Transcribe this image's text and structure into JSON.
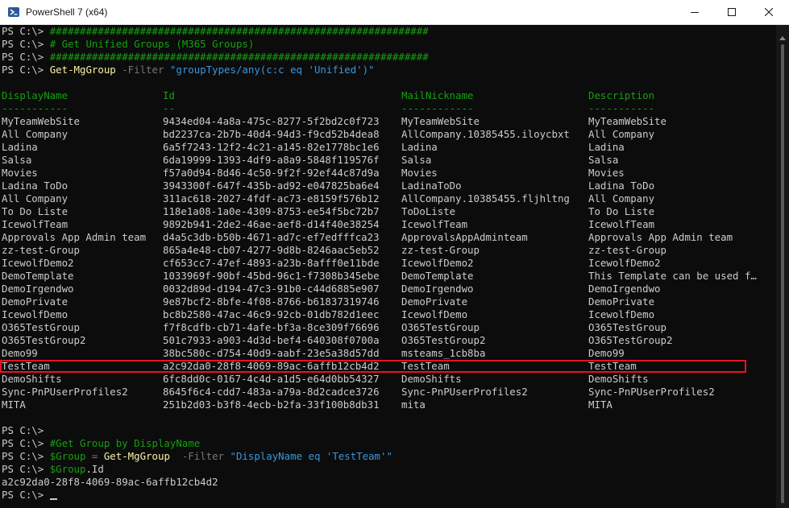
{
  "window": {
    "title": "PowerShell 7 (x64)"
  },
  "terminal": {
    "prompt": "PS C:\\> ",
    "comment_hashes": "###############################################################",
    "comment_title": "# Get Unified Groups (M365 Groups)",
    "cmd1": {
      "cmdlet": "Get-MgGroup",
      "param": "-Filter",
      "value": "\"groupTypes/any(c:c eq 'Unified')\""
    },
    "table": {
      "headers": [
        "DisplayName",
        "Id",
        "MailNickname",
        "Description"
      ],
      "underlines": [
        "-----------",
        "--",
        "------------",
        "-----------"
      ],
      "rows": [
        [
          "MyTeamWebSite",
          "9434ed04-4a8a-475c-8277-5f2bd2c0f723",
          "MyTeamWebSite",
          "MyTeamWebSite"
        ],
        [
          "All Company",
          "bd2237ca-2b7b-40d4-94d3-f9cd52b4dea8",
          "AllCompany.10385455.iloycbxt",
          "All Company"
        ],
        [
          "Ladina",
          "6a5f7243-12f2-4c21-a145-82e1778bc1e6",
          "Ladina",
          "Ladina"
        ],
        [
          "Salsa",
          "6da19999-1393-4df9-a8a9-5848f119576f",
          "Salsa",
          "Salsa"
        ],
        [
          "Movies",
          "f57a0d94-8d46-4c50-9f2f-92ef44c87d9a",
          "Movies",
          "Movies"
        ],
        [
          "Ladina ToDo",
          "3943300f-647f-435b-ad92-e047825ba6e4",
          "LadinaToDo",
          "Ladina ToDo"
        ],
        [
          "All Company",
          "311ac618-2027-4fdf-ac73-e8159f576b12",
          "AllCompany.10385455.fljhltng",
          "All Company"
        ],
        [
          "To Do Liste",
          "118e1a08-1a0e-4309-8753-ee54f5bc72b7",
          "ToDoListe",
          "To Do Liste"
        ],
        [
          "IcewolfTeam",
          "9892b941-2de2-46ae-aef8-d14f40e38254",
          "IcewolfTeam",
          "IcewolfTeam"
        ],
        [
          "Approvals App Admin team",
          "d4a5c3db-b50b-4671-ad7c-ef7edfffca23",
          "ApprovalsAppAdminteam",
          "Approvals App Admin team"
        ],
        [
          "zz-test-Group",
          "865a4e48-cb07-4277-9d8b-8246aac5eb52",
          "zz-test-Group",
          "zz-test-Group"
        ],
        [
          "IcewolfDemo2",
          "cf653cc7-47ef-4893-a23b-8afff0e11bde",
          "IcewolfDemo2",
          "IcewolfDemo2"
        ],
        [
          "DemoTemplate",
          "1033969f-90bf-45bd-96c1-f7308b345ebe",
          "DemoTemplate",
          "This Template can be used f…"
        ],
        [
          "DemoIrgendwo",
          "0032d89d-d194-47c3-91b0-c44d6885e907",
          "DemoIrgendwo",
          "DemoIrgendwo"
        ],
        [
          "DemoPrivate",
          "9e87bcf2-8bfe-4f08-8766-b61837319746",
          "DemoPrivate",
          "DemoPrivate"
        ],
        [
          "IcewolfDemo",
          "bc8b2580-47ac-46c9-92cb-01db782d1eec",
          "IcewolfDemo",
          "IcewolfDemo"
        ],
        [
          "O365TestGroup",
          "f7f8cdfb-cb71-4afe-bf3a-8ce309f76696",
          "O365TestGroup",
          "O365TestGroup"
        ],
        [
          "O365TestGroup2",
          "501c7933-a903-4d3d-bef4-640308f0700a",
          "O365TestGroup2",
          "O365TestGroup2"
        ],
        [
          "Demo99",
          "38bc580c-d754-40d9-aabf-23e5a38d57dd",
          "msteams_1cb8ba",
          "Demo99"
        ],
        [
          "TestTeam",
          "a2c92da0-28f8-4069-89ac-6affb12cb4d2",
          "TestTeam",
          "TestTeam"
        ],
        [
          "DemoShifts",
          "6fc8dd0c-0167-4c4d-a1d5-e64d0bb54327",
          "DemoShifts",
          "DemoShifts"
        ],
        [
          "Sync-PnPUserProfiles2",
          "8645f6c4-cdd7-483a-a79a-8d2cadce3726",
          "Sync-PnPUserProfiles2",
          "Sync-PnPUserProfiles2"
        ],
        [
          "MITA",
          "251b2d03-b3f8-4ecb-b2fa-33f100b8db31",
          "mita",
          "MITA"
        ]
      ]
    },
    "comment2": "#Get Group by DisplayName",
    "cmd2": {
      "var": "$Group",
      "eq": " = ",
      "cmdlet": "Get-MgGroup",
      "param": "  -Filter",
      "value": " \"DisplayName eq 'TestTeam'\""
    },
    "cmd3": {
      "var": "$Group",
      "prop": ".Id"
    },
    "output_id": "a2c92da0-28f8-4069-89ac-6affb12cb4d2"
  },
  "colors": {
    "background": "#0c0c0c",
    "comment": "#13a10e",
    "cmdlet": "#f9f1a5",
    "string": "#3a96dd",
    "highlight_box": "#e81123"
  }
}
